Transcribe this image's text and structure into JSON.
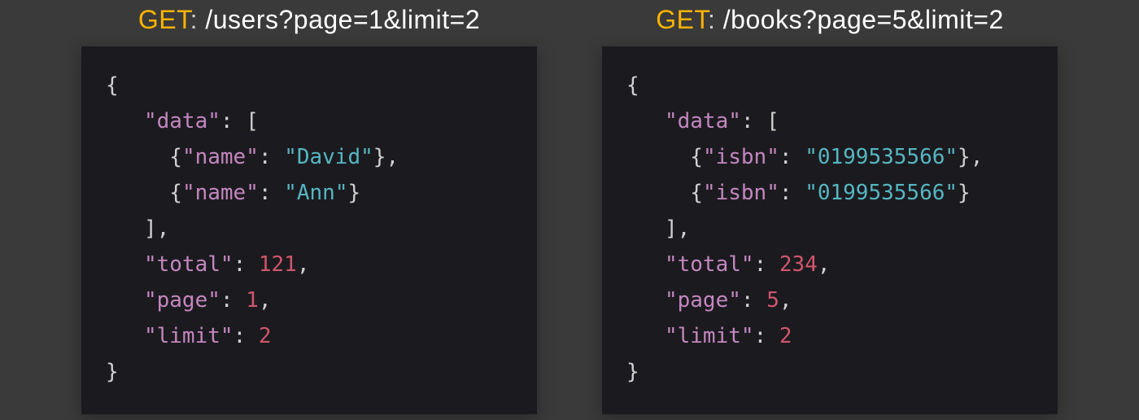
{
  "panels": [
    {
      "method": "GET",
      "path": "/users?page=1&limit=2",
      "response": {
        "data_key": "data",
        "item_key": "name",
        "items": [
          "David",
          "Ann"
        ],
        "total_key": "total",
        "total": 121,
        "page_key": "page",
        "page": 1,
        "limit_key": "limit",
        "limit": 2
      }
    },
    {
      "method": "GET",
      "path": "/books?page=5&limit=2",
      "response": {
        "data_key": "data",
        "item_key": "isbn",
        "items": [
          "0199535566",
          "0199535566"
        ],
        "total_key": "total",
        "total": 234,
        "page_key": "page",
        "page": 5,
        "limit_key": "limit",
        "limit": 2
      }
    }
  ],
  "colors": {
    "method": "#ffb300",
    "key": "#c586c0",
    "string": "#56b6c2",
    "number": "#d1556d",
    "background": "#3a3a3a",
    "code_bg": "#1b1b1f"
  }
}
